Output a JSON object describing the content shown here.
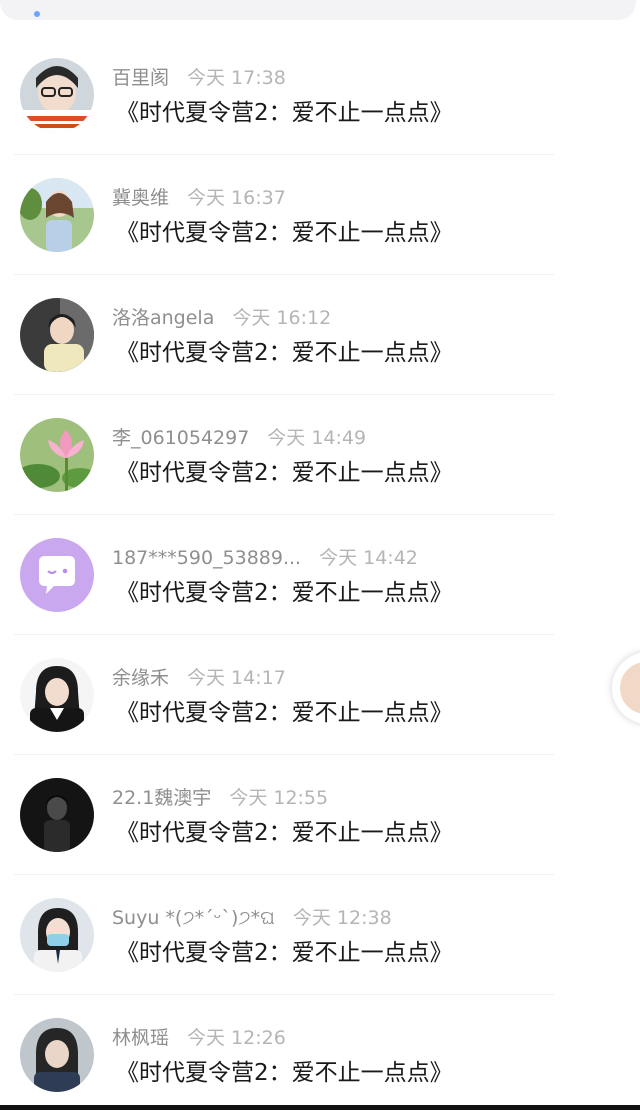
{
  "rows": [
    {
      "name": "百里阂",
      "time": "今天 17:38",
      "message": "《时代夏令营2：爱不止一点点》",
      "avatar": "user-avatar-photo"
    },
    {
      "name": "冀奥维",
      "time": "今天 16:37",
      "message": "《时代夏令营2：爱不止一点点》",
      "avatar": "user-avatar-photo"
    },
    {
      "name": "洛洛angela",
      "time": "今天 16:12",
      "message": "《时代夏令营2：爱不止一点点》",
      "avatar": "user-avatar-photo"
    },
    {
      "name": "李_061054297",
      "time": "今天 14:49",
      "message": "《时代夏令营2：爱不止一点点》",
      "avatar": "lotus-avatar"
    },
    {
      "name": "187***590_53889...",
      "time": "今天 14:42",
      "message": "《时代夏令营2：爱不止一点点》",
      "avatar": "default-chat-avatar"
    },
    {
      "name": "余缘禾",
      "time": "今天 14:17",
      "message": "《时代夏令营2：爱不止一点点》",
      "avatar": "user-avatar-photo"
    },
    {
      "name": "22.1魏澳宇",
      "time": "今天 12:55",
      "message": "《时代夏令营2：爱不止一点点》",
      "avatar": "user-avatar-photo"
    },
    {
      "name": "Suyu *(੭*ˊᵕˋ)੭*ଘ",
      "time": "今天 12:38",
      "message": "《时代夏令营2：爱不止一点点》",
      "avatar": "user-avatar-photo"
    },
    {
      "name": "林枫瑶",
      "time": "今天 12:26",
      "message": "《时代夏令营2：爱不止一点点》",
      "avatar": "user-avatar-photo"
    }
  ],
  "colors": {
    "name_text": "#8f8f8f",
    "time_text": "#b5b5b5",
    "message_text": "#1a1a1a",
    "default_avatar": "#c9a8f0"
  }
}
